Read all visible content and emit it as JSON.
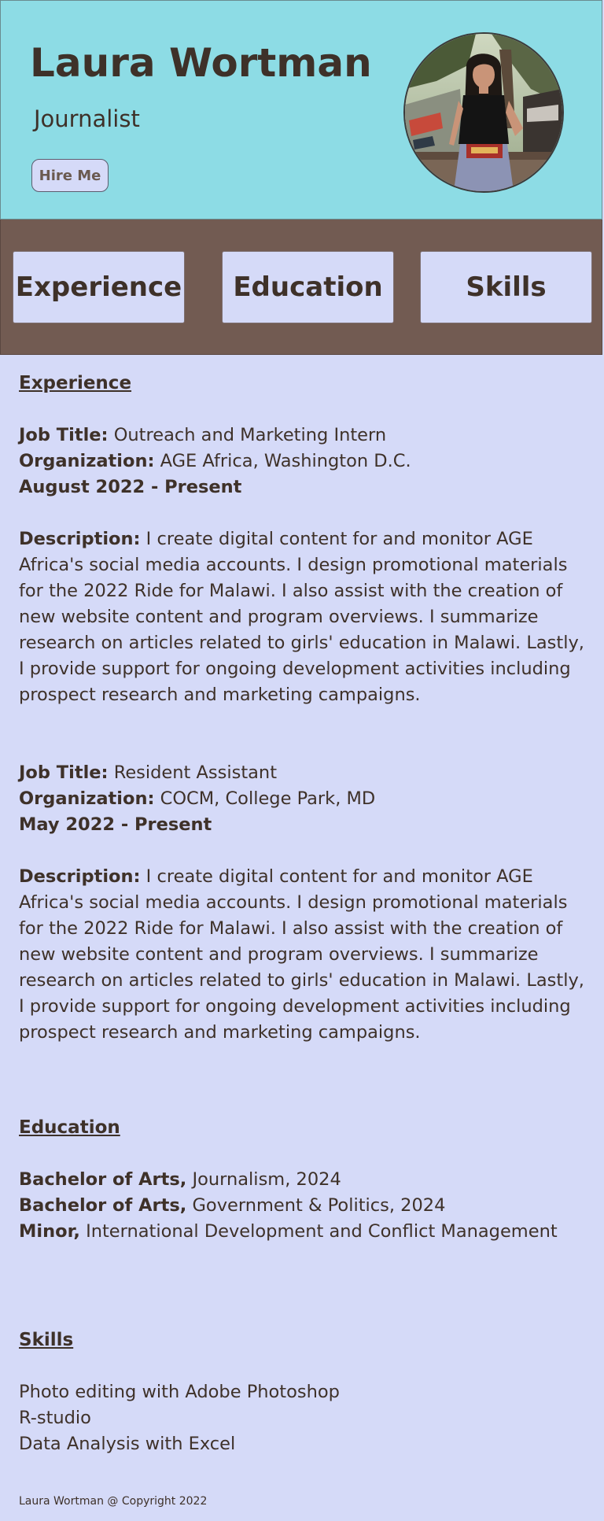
{
  "header": {
    "name": "Laura Wortman",
    "role": "Journalist",
    "hire_label": "Hire Me"
  },
  "nav": {
    "experience": "Experience",
    "education": "Education",
    "skills": "Skills"
  },
  "experience": {
    "title": "Experience",
    "jobs": [
      {
        "job_title_label": "Job Title:",
        "job_title": " Outreach and Marketing Intern",
        "org_label": "Organization:",
        "org": " AGE Africa, Washington D.C.",
        "dates": "August 2022 - Present",
        "desc_label": "Description:",
        "desc": " I create digital content for and monitor AGE Africa's social media accounts. I design promotional materials for the 2022 Ride for Malawi. I also assist with the creation of new website content and program overviews. I summarize research on articles related to girls' education in Malawi. Lastly, I provide support for ongoing development activities including prospect research and marketing campaigns."
      },
      {
        "job_title_label": "Job Title:",
        "job_title": " Resident Assistant",
        "org_label": "Organization:",
        "org": " COCM, College Park, MD",
        "dates": "May 2022 - Present",
        "desc_label": "Description:",
        "desc": " I create digital content for and monitor AGE Africa's social media accounts. I design promotional materials for the 2022 Ride for Malawi. I also assist with the creation of new website content and program overviews. I summarize research on articles related to girls' education in Malawi. Lastly, I provide support for ongoing development activities including prospect research and marketing campaigns."
      }
    ]
  },
  "education": {
    "title": "Education",
    "items": [
      {
        "label": "Bachelor of Arts,",
        "value": " Journalism, 2024"
      },
      {
        "label": "Bachelor of Arts,",
        "value": " Government & Politics, 2024"
      },
      {
        "label": "Minor,",
        "value": " International Development and Conflict Management"
      }
    ]
  },
  "skills": {
    "title": "Skills",
    "items": [
      "Photo editing with Adobe Photoshop",
      "R-studio",
      "Data Analysis with Excel"
    ]
  },
  "footer": {
    "text": "Laura Wortman @ Copyright 2022"
  }
}
